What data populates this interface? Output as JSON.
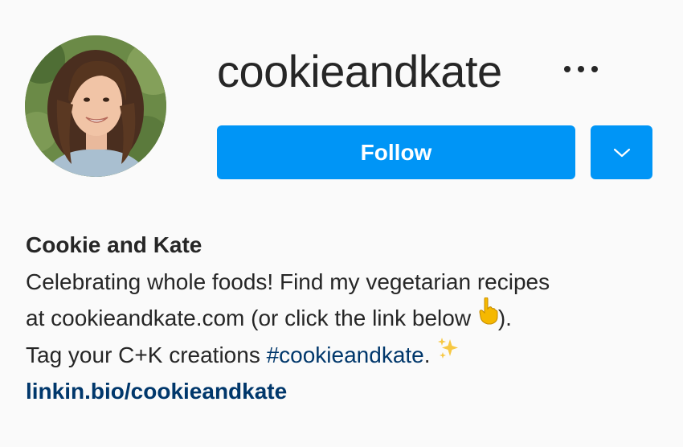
{
  "profile": {
    "username": "cookieandkate",
    "display_name": "Cookie and Kate",
    "more_icon": "ellipsis-icon"
  },
  "actions": {
    "follow_label": "Follow",
    "dropdown_icon": "chevron-down-icon",
    "accent_color": "#0095f6"
  },
  "bio": {
    "line1": "Celebrating whole foods! Find my vegetarian recipes",
    "line2_before": "at cookieandkate.com (or click the link below ",
    "line2_emoji": "pointing-down-icon",
    "line2_after": ").",
    "line3_before": "Tag your C+K creations ",
    "hashtag": "#cookieandkate",
    "line3_after": ". ",
    "line3_emoji": "sparkles-icon",
    "link": "linkin.bio/cookieandkate",
    "link_color": "#00376b"
  }
}
